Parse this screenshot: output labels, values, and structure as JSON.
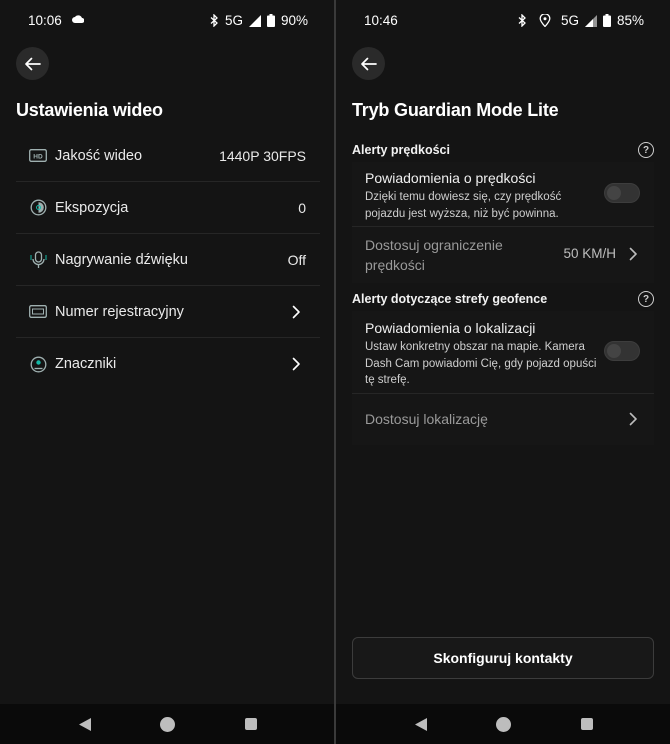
{
  "left": {
    "status": {
      "time": "10:06",
      "network": "5G",
      "battery": "90%"
    },
    "title": "Ustawienia wideo",
    "rows": [
      {
        "icon": "hd-icon",
        "label": "Jakość wideo",
        "value": "1440P 30FPS"
      },
      {
        "icon": "exposure-icon",
        "label": "Ekspozycja",
        "value": "0"
      },
      {
        "icon": "microphone-icon",
        "label": "Nagrywanie dźwięku",
        "value": "Off"
      },
      {
        "icon": "license-plate-icon",
        "label": "Numer rejestracyjny",
        "value": ""
      },
      {
        "icon": "badge-icon",
        "label": "Znaczniki",
        "value": ""
      }
    ]
  },
  "right": {
    "status": {
      "time": "10:46",
      "network": "5G",
      "battery": "85%"
    },
    "title": "Tryb Guardian Mode Lite",
    "speed_section": {
      "heading": "Alerty prędkości",
      "notify_title": "Powiadomienia o prędkości",
      "notify_desc": "Dzięki temu dowiesz się, czy prędkość pojazdu jest wyższa, niż być powinna.",
      "limit_title": "Dostosuj ograniczenie prędkości",
      "limit_value": "50 KM/H"
    },
    "geo_section": {
      "heading": "Alerty dotyczące strefy geofence",
      "notify_title": "Powiadomienia o lokalizacji",
      "notify_desc": "Ustaw konkretny obszar na mapie. Kamera Dash Cam powiadomi Cię, gdy pojazd opuści tę strefę.",
      "location_title": "Dostosuj lokalizację"
    },
    "contacts_button": "Skonfiguruj kontakty"
  },
  "help_symbol": "?"
}
